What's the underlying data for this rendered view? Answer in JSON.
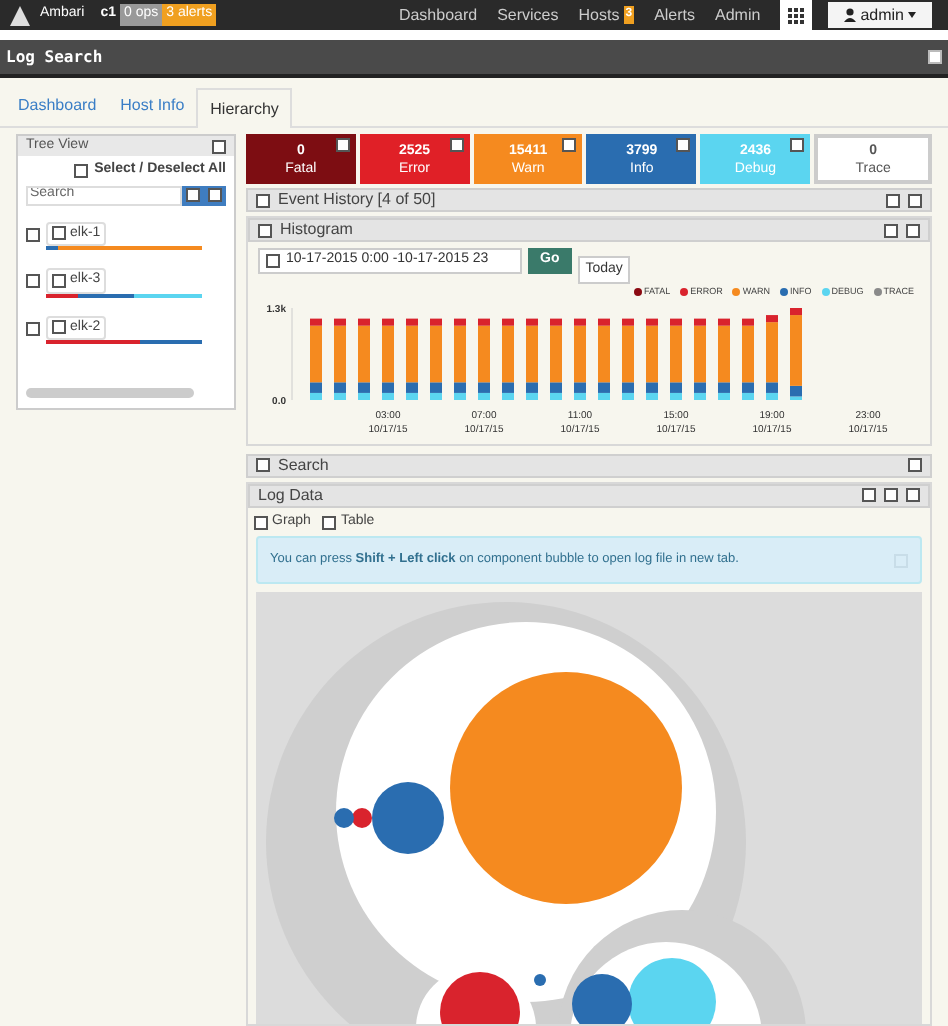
{
  "navbar": {
    "brand": "Ambari",
    "cluster": "c1",
    "ops_badge": "0 ops",
    "alerts_badge": "3 alerts",
    "links": [
      {
        "label": "Dashboard"
      },
      {
        "label": "Services"
      },
      {
        "label": "Hosts",
        "badge": "3"
      },
      {
        "label": "Alerts"
      },
      {
        "label": "Admin"
      }
    ],
    "user": "admin"
  },
  "page_title": "Log Search",
  "tabs": [
    {
      "label": "Dashboard",
      "selected": false
    },
    {
      "label": "Host Info",
      "selected": false
    },
    {
      "label": "Hierarchy",
      "selected": true
    }
  ],
  "tree_view": {
    "title": "Tree View",
    "select_all": "Select / Deselect All",
    "search_placeholder": "Search",
    "hosts": [
      {
        "name": "elk-1",
        "segments": [
          {
            "color": "#2a6db0",
            "level": 0.08
          },
          {
            "color": "#f58a1f",
            "level": 0.92
          }
        ]
      },
      {
        "name": "elk-3",
        "segments": [
          {
            "color": "#d9232d",
            "level": 0.2
          },
          {
            "color": "#2a6db0",
            "level": 0.36
          },
          {
            "color": "#5bd5f0",
            "level": 0.44
          }
        ]
      },
      {
        "name": "elk-2",
        "segments": [
          {
            "color": "#d9232d",
            "level": 0.6
          },
          {
            "color": "#2a6db0",
            "level": 0.4
          }
        ]
      }
    ]
  },
  "level_tiles": [
    {
      "count": "0",
      "label": "Fatal",
      "kind": "fatal"
    },
    {
      "count": "2525",
      "label": "Error",
      "kind": "error"
    },
    {
      "count": "15411",
      "label": "Warn",
      "kind": "warn"
    },
    {
      "count": "3799",
      "label": "Info",
      "kind": "info"
    },
    {
      "count": "2436",
      "label": "Debug",
      "kind": "debug"
    },
    {
      "count": "0",
      "label": "Trace",
      "kind": "trace"
    }
  ],
  "event_history": {
    "title": "Event History [4 of 50]"
  },
  "histogram": {
    "title": "Histogram",
    "date_range": "10-17-2015 0:00 -10-17-2015 23",
    "go": "Go",
    "today": "Today",
    "chart_data": {
      "type": "bar",
      "stacked": true,
      "categories": [
        null,
        null,
        null,
        "03:00 10/17/15",
        null,
        null,
        null,
        "07:00 10/17/15",
        null,
        null,
        null,
        "11:00 10/17/15",
        null,
        null,
        null,
        "15:00 10/17/15",
        null,
        null,
        null,
        "19:00 10/17/15",
        null,
        null,
        null,
        "23:00 10/17/15"
      ],
      "ylim": [
        0,
        1300
      ],
      "yticks": [
        {
          "value": 0,
          "label": "0.0"
        },
        {
          "value": 1300,
          "label": "1.3k"
        }
      ],
      "series": [
        {
          "name": "FATAL",
          "color": "#8b0a12",
          "values": [
            0,
            0,
            0,
            0,
            0,
            0,
            0,
            0,
            0,
            0,
            0,
            0,
            0,
            0,
            0,
            0,
            0,
            0,
            0,
            0,
            0,
            null,
            null,
            null
          ]
        },
        {
          "name": "ERROR",
          "color": "#d9232d",
          "values": [
            100,
            100,
            100,
            100,
            100,
            100,
            100,
            100,
            100,
            100,
            100,
            100,
            100,
            100,
            100,
            100,
            100,
            100,
            100,
            100,
            100,
            null,
            null,
            null
          ]
        },
        {
          "name": "WARN",
          "color": "#f58a1f",
          "values": [
            800,
            800,
            800,
            800,
            800,
            800,
            800,
            800,
            800,
            800,
            800,
            800,
            800,
            800,
            800,
            800,
            800,
            800,
            800,
            850,
            1000,
            null,
            null,
            null
          ]
        },
        {
          "name": "INFO",
          "color": "#2a6db0",
          "values": [
            150,
            150,
            150,
            150,
            150,
            150,
            150,
            150,
            150,
            150,
            150,
            150,
            150,
            150,
            150,
            150,
            150,
            150,
            150,
            150,
            150,
            null,
            null,
            null
          ]
        },
        {
          "name": "DEBUG",
          "color": "#5bd5f0",
          "values": [
            100,
            100,
            100,
            100,
            100,
            100,
            100,
            100,
            100,
            100,
            100,
            100,
            100,
            100,
            100,
            100,
            100,
            100,
            100,
            100,
            50,
            null,
            null,
            null
          ]
        },
        {
          "name": "TRACE",
          "color": "#8a8a8a",
          "values": [
            0,
            0,
            0,
            0,
            0,
            0,
            0,
            0,
            0,
            0,
            0,
            0,
            0,
            0,
            0,
            0,
            0,
            0,
            0,
            0,
            0,
            null,
            null,
            null
          ]
        }
      ]
    }
  },
  "search_panel": {
    "title": "Search"
  },
  "log_data": {
    "title": "Log Data",
    "views": [
      {
        "label": "Graph"
      },
      {
        "label": "Table"
      }
    ],
    "notice": "You can press **Shift + Left click** on component bubble to open log file in new tab."
  }
}
